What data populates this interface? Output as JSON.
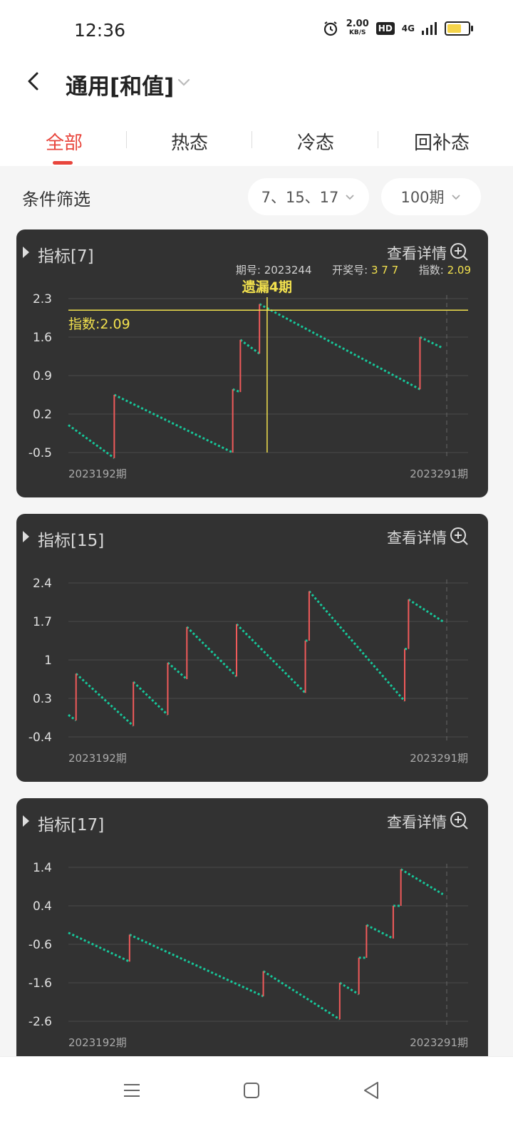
{
  "status": {
    "time": "12:36",
    "speed_value": "2.00",
    "speed_unit": "KB/S",
    "hd": "HD",
    "network": "4G"
  },
  "header": {
    "title": "通用[和值]"
  },
  "tabs": [
    {
      "label": "全部",
      "active": true
    },
    {
      "label": "热态",
      "active": false
    },
    {
      "label": "冷态",
      "active": false
    },
    {
      "label": "回补态",
      "active": false
    }
  ],
  "filter": {
    "label": "条件筛选",
    "numbers": "7、15、17",
    "periods": "100期"
  },
  "cards": [
    {
      "title": "指标[7]",
      "detail": "查看详情",
      "info": {
        "issue_label": "期号:",
        "issue": "2023244",
        "draw_label": "开奖号:",
        "draw": "3 7 7",
        "index_label": "指数:",
        "index": "2.09"
      },
      "miss_label": "遗漏4期",
      "ref_label": "指数:2.09",
      "x_start": "2023192期",
      "x_end": "2023291期"
    },
    {
      "title": "指标[15]",
      "detail": "查看详情",
      "x_start": "2023192期",
      "x_end": "2023291期"
    },
    {
      "title": "指标[17]",
      "detail": "查看详情",
      "x_start": "2023192期",
      "x_end": "2023291期"
    }
  ],
  "chart_data": [
    {
      "type": "line",
      "title": "指标[7]",
      "x_start": "2023192期",
      "x_end": "2023291期",
      "y_ticks": [
        2.3,
        1.6,
        0.9,
        0.2,
        -0.5
      ],
      "ylim": [
        -0.5,
        2.3
      ],
      "reference_line": 2.09,
      "highlight_issue": "2023244",
      "segments": [
        [
          [
            0,
            0.0
          ],
          [
            12,
            -0.6
          ]
        ],
        [
          [
            12,
            0.55
          ],
          [
            43,
            -0.5
          ]
        ],
        [
          [
            43,
            0.65
          ],
          [
            45,
            0.6
          ]
        ],
        [
          [
            45,
            1.55
          ],
          [
            50,
            1.3
          ]
        ],
        [
          [
            50,
            2.2
          ],
          [
            92,
            0.65
          ]
        ],
        [
          [
            92,
            1.6
          ],
          [
            98,
            1.4
          ]
        ]
      ],
      "jumps": [
        [
          12,
          -0.6,
          0.55
        ],
        [
          43,
          -0.5,
          0.65
        ],
        [
          45,
          0.6,
          1.55
        ],
        [
          50,
          1.3,
          2.2
        ],
        [
          92,
          0.65,
          1.6
        ]
      ]
    },
    {
      "type": "line",
      "title": "指标[15]",
      "x_start": "2023192期",
      "x_end": "2023291期",
      "y_ticks": [
        2.4,
        1.7,
        1,
        0.3,
        -0.4
      ],
      "ylim": [
        -0.4,
        2.4
      ],
      "segments": [
        [
          [
            0,
            0.0
          ],
          [
            2,
            -0.1
          ]
        ],
        [
          [
            2,
            0.75
          ],
          [
            17,
            -0.2
          ]
        ],
        [
          [
            17,
            0.6
          ],
          [
            26,
            0.0
          ]
        ],
        [
          [
            26,
            0.95
          ],
          [
            31,
            0.65
          ]
        ],
        [
          [
            31,
            1.6
          ],
          [
            44,
            0.7
          ]
        ],
        [
          [
            44,
            1.65
          ],
          [
            62,
            0.4
          ]
        ],
        [
          [
            62,
            1.35
          ],
          [
            63,
            1.35
          ]
        ],
        [
          [
            63,
            2.25
          ],
          [
            88,
            0.25
          ]
        ],
        [
          [
            88,
            1.2
          ],
          [
            89,
            1.2
          ]
        ],
        [
          [
            89,
            2.1
          ],
          [
            98,
            1.7
          ]
        ]
      ],
      "jumps": [
        [
          2,
          -0.1,
          0.75
        ],
        [
          17,
          -0.2,
          0.6
        ],
        [
          26,
          0.0,
          0.95
        ],
        [
          31,
          0.65,
          1.6
        ],
        [
          44,
          0.7,
          1.65
        ],
        [
          62,
          0.4,
          1.35
        ],
        [
          63,
          1.35,
          2.25
        ],
        [
          88,
          0.25,
          1.2
        ],
        [
          89,
          1.2,
          2.1
        ]
      ]
    },
    {
      "type": "line",
      "title": "指标[17]",
      "x_start": "2023192期",
      "x_end": "2023291期",
      "y_ticks": [
        1.4,
        0.4,
        -0.6,
        -1.6,
        -2.6
      ],
      "ylim": [
        -2.6,
        1.4
      ],
      "segments": [
        [
          [
            0,
            -0.3
          ],
          [
            16,
            -1.05
          ]
        ],
        [
          [
            16,
            -0.35
          ],
          [
            51,
            -1.95
          ]
        ],
        [
          [
            51,
            -1.3
          ],
          [
            71,
            -2.55
          ]
        ],
        [
          [
            71,
            -1.6
          ],
          [
            76,
            -1.9
          ]
        ],
        [
          [
            76,
            -0.95
          ],
          [
            78,
            -0.95
          ]
        ],
        [
          [
            78,
            -0.1
          ],
          [
            85,
            -0.45
          ]
        ],
        [
          [
            85,
            0.4
          ],
          [
            87,
            0.4
          ]
        ],
        [
          [
            87,
            1.35
          ],
          [
            98,
            0.7
          ]
        ]
      ],
      "jumps": [
        [
          16,
          -1.05,
          -0.35
        ],
        [
          51,
          -1.95,
          -1.3
        ],
        [
          71,
          -2.55,
          -1.6
        ],
        [
          76,
          -1.9,
          -0.95
        ],
        [
          78,
          -0.95,
          -0.1
        ],
        [
          85,
          -0.45,
          0.4
        ],
        [
          87,
          0.4,
          1.35
        ]
      ]
    }
  ],
  "colors": {
    "accent": "#e8453c",
    "card_bg": "#323232",
    "line_green": "#16c79a",
    "jump_red": "#f05a5a",
    "highlight_yellow": "#f2e14e"
  },
  "icons": {
    "back": "back-icon",
    "chevron": "chevron-down-icon",
    "zoom": "zoom-in-icon",
    "triangle": "expand-triangle-icon"
  }
}
